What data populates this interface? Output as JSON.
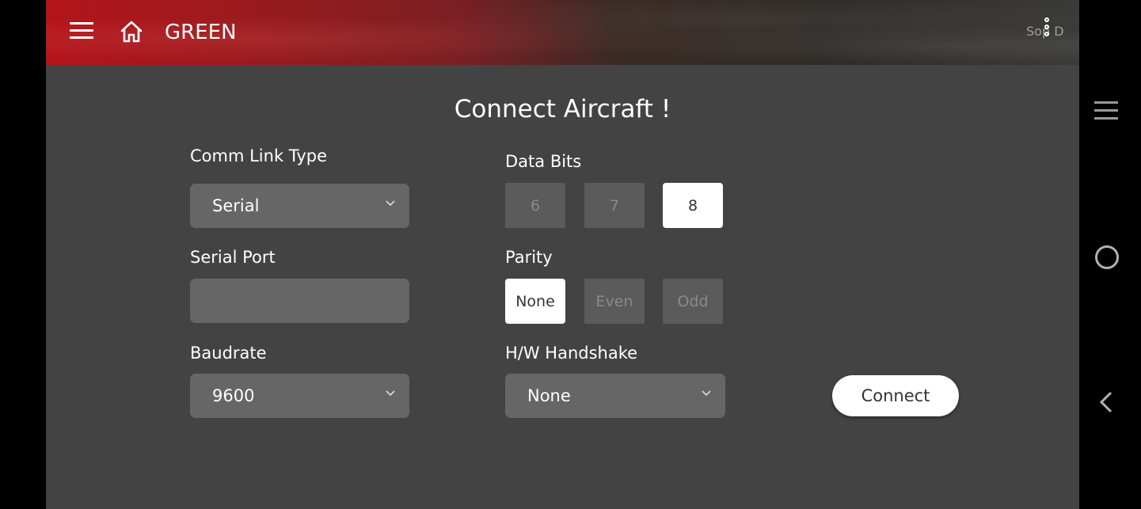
{
  "header": {
    "brand": "GREEN",
    "map_overlay_text": "Sop D",
    "icons": {
      "menu": "menu-icon",
      "home": "home-icon",
      "more": "more-vertical-icon"
    }
  },
  "page": {
    "title": "Connect Aircraft !"
  },
  "form": {
    "comm_link_type": {
      "label": "Comm Link Type",
      "value": "Serial"
    },
    "serial_port": {
      "label": "Serial Port",
      "value": ""
    },
    "baudrate": {
      "label": "Baudrate",
      "value": "9600"
    },
    "data_bits": {
      "label": "Data Bits",
      "options": [
        "6",
        "7",
        "8"
      ],
      "selected": "8"
    },
    "parity": {
      "label": "Parity",
      "options": [
        "None",
        "Even",
        "Odd"
      ],
      "selected": "None"
    },
    "hw_handshake": {
      "label": "H/W Handshake",
      "value": "None"
    },
    "connect_label": "Connect"
  },
  "system_nav": {
    "icons": [
      "recent-apps-icon",
      "home-circle-icon",
      "back-icon"
    ]
  },
  "colors": {
    "panel_bg": "#434343",
    "field_bg": "#666666",
    "segment_inactive": "#5b5b5b",
    "segment_active": "#ffffff",
    "header_accent": "#b3141a"
  }
}
